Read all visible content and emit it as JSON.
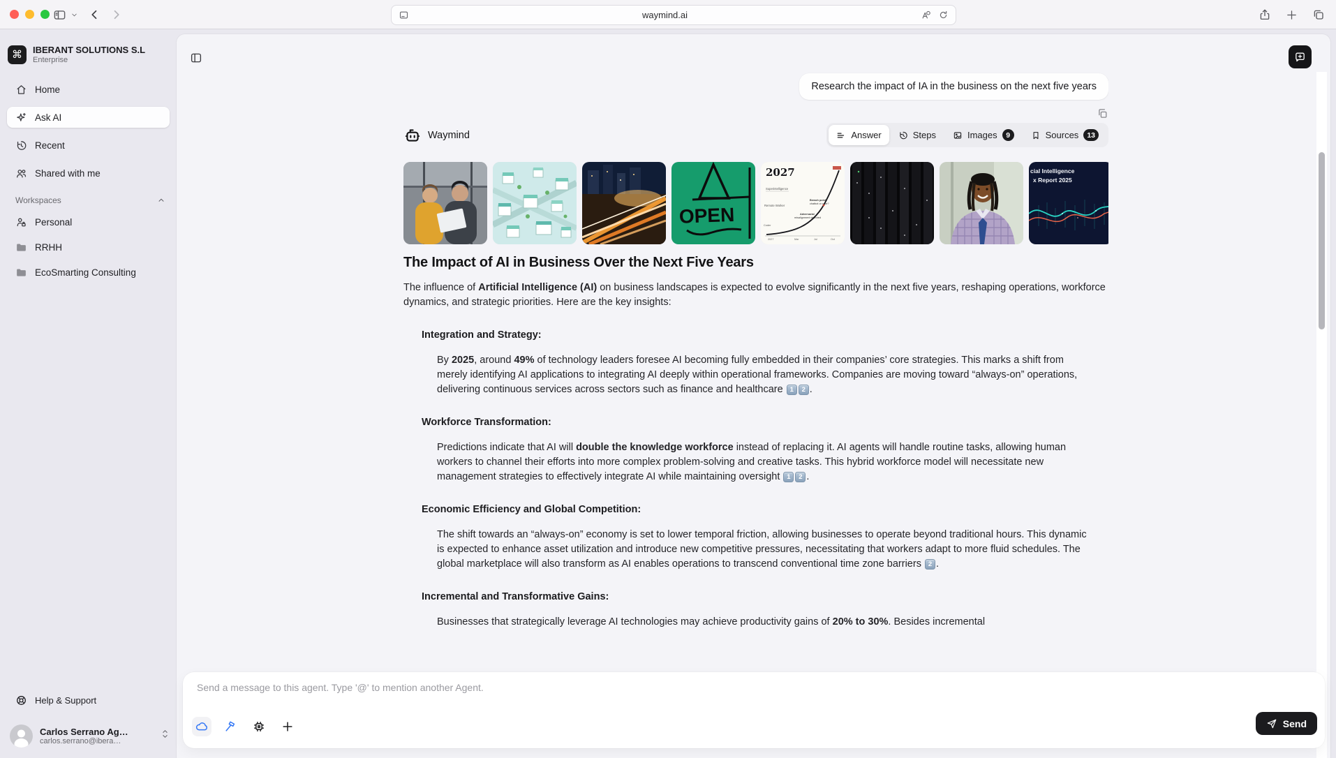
{
  "browser": {
    "url": "waymind.ai",
    "traffic_lights": {
      "close": "#ff5f57",
      "minimize": "#febc2e",
      "zoom": "#28c840"
    }
  },
  "sidebar": {
    "org_name": "IBERANT SOLUTIONS S.L",
    "org_plan": "Enterprise",
    "nav": [
      {
        "label": "Home"
      },
      {
        "label": "Ask AI",
        "active": true
      },
      {
        "label": "Recent"
      },
      {
        "label": "Shared with me"
      }
    ],
    "workspaces_label": "Workspaces",
    "workspaces": [
      {
        "label": "Personal"
      },
      {
        "label": "RRHH"
      },
      {
        "label": "EcoSmarting Consulting"
      }
    ],
    "help_label": "Help & Support",
    "user": {
      "name": "Carlos Serrano Ag…",
      "email": "carlos.serrano@ibera…"
    }
  },
  "chat": {
    "user_query": "Research the impact of IA in the business on the next five years",
    "agent_name": "Waymind",
    "tabs": [
      {
        "label": "Answer",
        "active": true
      },
      {
        "label": "Steps"
      },
      {
        "label": "Images",
        "badge": "9"
      },
      {
        "label": "Sources",
        "badge": "13"
      }
    ],
    "thumbnails": [
      {
        "name": "colleagues-reviewing-laptop"
      },
      {
        "name": "isometric-city-illustration"
      },
      {
        "name": "night-train-light-trails"
      },
      {
        "name": "open-sign",
        "visible_text": "OPEN"
      },
      {
        "name": "2027-forecast-chart",
        "visible_text": "2027"
      },
      {
        "name": "server-racks"
      },
      {
        "name": "smiling-professional"
      },
      {
        "name": "ai-index-report-2025",
        "visible_text_line1": "cial Intelligence",
        "visible_text_line2": "x Report 2025"
      }
    ],
    "answer": {
      "title": "The Impact of AI in Business Over the Next Five Years",
      "intro": [
        {
          "text": "The influence of "
        },
        {
          "text": "Artificial Intelligence (AI)",
          "bold": true
        },
        {
          "text": " on business landscapes is expected to evolve significantly in the next five years, reshaping operations, workforce dynamics, and strategic priorities. Here are the key insights:"
        }
      ],
      "sections": [
        {
          "heading": "Integration and Strategy:",
          "body": [
            {
              "text": "By "
            },
            {
              "text": "2025",
              "bold": true
            },
            {
              "text": ", around "
            },
            {
              "text": "49%",
              "bold": true
            },
            {
              "text": " of technology leaders foresee AI becoming fully embedded in their companies’ core strategies. This marks a shift from merely identifying AI applications to integrating AI deeply within operational frameworks. Companies are moving toward “always-on” operations, delivering continuous services across sectors such as finance and healthcare "
            },
            {
              "cite": "1"
            },
            {
              "cite": "2"
            },
            {
              "text": "."
            }
          ]
        },
        {
          "heading": "Workforce Transformation:",
          "body": [
            {
              "text": "Predictions indicate that AI will "
            },
            {
              "text": "double the knowledge workforce",
              "bold": true
            },
            {
              "text": " instead of replacing it. AI agents will handle routine tasks, allowing human workers to channel their efforts into more complex problem-solving and creative tasks. This hybrid workforce model will necessitate new management strategies to effectively integrate AI while maintaining oversight "
            },
            {
              "cite": "1"
            },
            {
              "cite": "2"
            },
            {
              "text": "."
            }
          ]
        },
        {
          "heading": "Economic Efficiency and Global Competition:",
          "body": [
            {
              "text": "The shift towards an “always-on” economy is set to lower temporal friction, allowing businesses to operate beyond traditional hours. This dynamic is expected to enhance asset utilization and introduce new competitive pressures, necessitating that workers adapt to more fluid schedules. The global marketplace will also transform as AI enables operations to transcend conventional time zone barriers "
            },
            {
              "cite": "2"
            },
            {
              "text": "."
            }
          ]
        },
        {
          "heading": "Incremental and Transformative Gains:",
          "body": [
            {
              "text": "Businesses that strategically leverage AI technologies may achieve productivity gains of "
            },
            {
              "text": "20% to 30%",
              "bold": true
            },
            {
              "text": ". Besides incremental"
            }
          ]
        }
      ]
    }
  },
  "composer": {
    "placeholder": "Send a message to this agent. Type '@' to mention another Agent.",
    "send_label": "Send"
  }
}
